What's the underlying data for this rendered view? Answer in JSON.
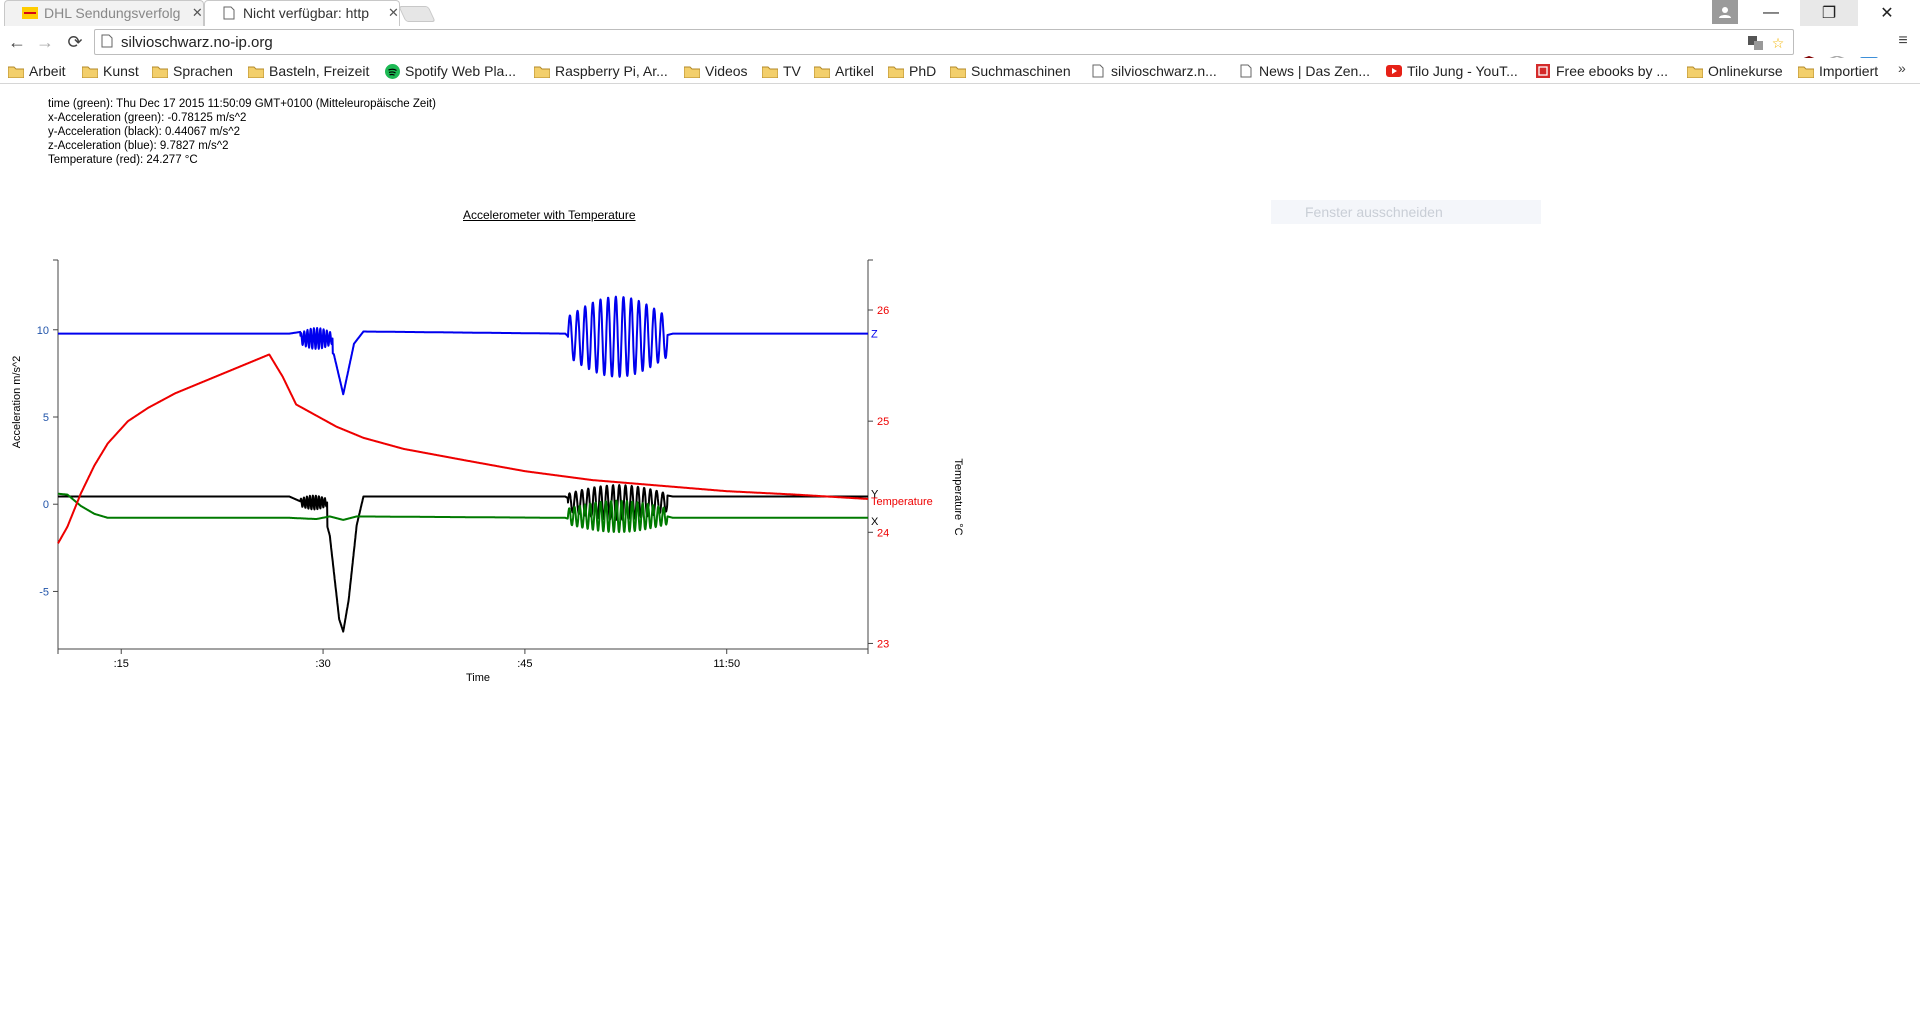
{
  "browser": {
    "tabs": [
      {
        "title": "DHL Sendungsverfolg",
        "active": false,
        "icon": "dhl-icon"
      },
      {
        "title": "Nicht verfügbar: http",
        "active": true,
        "icon": "page-icon"
      }
    ],
    "url": "silvioschwarz.no-ip.org",
    "window_controls": [
      "minimize",
      "restore",
      "close"
    ],
    "bookmarks": [
      {
        "label": "Arbeit",
        "icon": "folder-icon"
      },
      {
        "label": "Kunst",
        "icon": "folder-icon"
      },
      {
        "label": "Sprachen",
        "icon": "folder-icon"
      },
      {
        "label": "Basteln, Freizeit",
        "icon": "folder-icon"
      },
      {
        "label": "Spotify Web Pla...",
        "icon": "spotify-icon"
      },
      {
        "label": "Raspberry Pi, Ar...",
        "icon": "folder-icon"
      },
      {
        "label": "Videos",
        "icon": "folder-icon"
      },
      {
        "label": "TV",
        "icon": "folder-icon"
      },
      {
        "label": "Artikel",
        "icon": "folder-icon"
      },
      {
        "label": "PhD",
        "icon": "folder-icon"
      },
      {
        "label": "Suchmaschinen",
        "icon": "folder-icon"
      },
      {
        "label": "silvioschwarz.n...",
        "icon": "page-icon"
      },
      {
        "label": "News | Das Zen...",
        "icon": "page-icon"
      },
      {
        "label": "Tilo Jung - YouT...",
        "icon": "youtube-icon"
      },
      {
        "label": "Free ebooks by ...",
        "icon": "ebook-icon"
      },
      {
        "label": "Onlinekurse",
        "icon": "folder-icon"
      },
      {
        "label": "Importiert",
        "icon": "folder-icon"
      }
    ],
    "overflow": "»"
  },
  "readout": {
    "time": "time (green): Thu Dec 17 2015 11:50:09 GMT+0100 (Mitteleuropäische Zeit)",
    "x": "x-Acceleration (green): -0.78125 m/s^2",
    "y": "y-Acceleration (black): 0.44067 m/s^2",
    "z": "z-Acceleration (blue): 9.7827 m/s^2",
    "temp": "Temperature (red): 24.277 °C"
  },
  "ghost_tooltip": "Fenster ausschneiden",
  "chart_data": {
    "type": "line",
    "title": "Accelerometer with Temperature",
    "xlabel": "Time",
    "ylabel_left": "Acceleration m/s^2",
    "ylabel_right": "Temperature °C",
    "x_ticks": [
      ":15",
      ":30",
      ":45",
      "11:50"
    ],
    "x_tick_seconds": [
      15,
      30,
      45,
      60
    ],
    "xlim": [
      10.3,
      70.5
    ],
    "ylim_left": [
      -8.3,
      14
    ],
    "ylim_right": [
      22.95,
      26.45
    ],
    "y_ticks_left": [
      10,
      5,
      0,
      -5
    ],
    "y_ticks_right": [
      26,
      25,
      24,
      23
    ],
    "series_labels": {
      "z": "Z",
      "y": "Y",
      "x": "X",
      "temperature": "Temperature"
    },
    "colors": {
      "z": "#0000ee",
      "y": "#000000",
      "x": "#007a00",
      "temperature": "#ee0000",
      "left_axis": "#2255aa",
      "right_axis": "#ee0000"
    },
    "series": [
      {
        "name": "Z",
        "color": "#0000ee",
        "axis": "left",
        "points": [
          [
            10.3,
            9.78
          ],
          [
            27.5,
            9.78
          ],
          [
            28.5,
            9.9
          ],
          [
            29.5,
            9.4
          ],
          [
            30.8,
            8.6
          ],
          [
            31.5,
            6.3
          ],
          [
            32.3,
            9.2
          ],
          [
            33,
            9.9
          ],
          [
            48,
            9.78
          ],
          [
            48.5,
            9.4
          ],
          [
            55.6,
            9.7
          ],
          [
            56,
            9.78
          ],
          [
            70.5,
            9.78
          ]
        ]
      },
      {
        "name": "Y",
        "color": "#000000",
        "axis": "left",
        "points": [
          [
            10.3,
            0.44
          ],
          [
            27.5,
            0.44
          ],
          [
            28.5,
            0.1
          ],
          [
            29.8,
            0.2
          ],
          [
            30.5,
            -1.8
          ],
          [
            31.2,
            -6.6
          ],
          [
            31.5,
            -7.3
          ],
          [
            31.9,
            -5.5
          ],
          [
            32.5,
            -1.2
          ],
          [
            33,
            0.44
          ],
          [
            48,
            0.44
          ],
          [
            48.5,
            0.2
          ],
          [
            55.6,
            0.5
          ],
          [
            56,
            0.44
          ],
          [
            70.5,
            0.44
          ]
        ]
      },
      {
        "name": "X",
        "color": "#007a00",
        "axis": "left",
        "points": [
          [
            10.3,
            0.6
          ],
          [
            11,
            0.55
          ],
          [
            12,
            -0.1
          ],
          [
            13,
            -0.55
          ],
          [
            14,
            -0.78
          ],
          [
            27.5,
            -0.78
          ],
          [
            29.5,
            -0.85
          ],
          [
            30.5,
            -0.7
          ],
          [
            31.5,
            -0.9
          ],
          [
            32.5,
            -0.7
          ],
          [
            48,
            -0.78
          ],
          [
            48.5,
            -0.9
          ],
          [
            55.6,
            -0.7
          ],
          [
            56,
            -0.78
          ],
          [
            70.5,
            -0.78
          ]
        ]
      },
      {
        "name": "Temperature",
        "color": "#ee0000",
        "axis": "right",
        "points": [
          [
            10.3,
            23.9
          ],
          [
            11,
            24.05
          ],
          [
            12,
            24.35
          ],
          [
            13,
            24.6
          ],
          [
            14,
            24.8
          ],
          [
            15.5,
            25.0
          ],
          [
            17,
            25.12
          ],
          [
            19,
            25.25
          ],
          [
            21,
            25.35
          ],
          [
            23,
            25.45
          ],
          [
            25,
            25.55
          ],
          [
            26,
            25.6
          ],
          [
            27,
            25.4
          ],
          [
            28,
            25.15
          ],
          [
            29.5,
            25.05
          ],
          [
            31,
            24.95
          ],
          [
            33,
            24.85
          ],
          [
            36,
            24.75
          ],
          [
            40,
            24.66
          ],
          [
            45,
            24.55
          ],
          [
            50,
            24.47
          ],
          [
            55,
            24.42
          ],
          [
            60,
            24.37
          ],
          [
            65,
            24.34
          ],
          [
            70.5,
            24.3
          ]
        ]
      }
    ],
    "oscillations": [
      {
        "series": "Z",
        "x0": 28.3,
        "x1": 30.7,
        "center": 9.5,
        "amplitude": 0.6,
        "cycles": 10
      },
      {
        "series": "Z",
        "x0": 48.2,
        "x1": 55.6,
        "center": 9.6,
        "amplitude": 2.3,
        "cycles": 13
      },
      {
        "series": "Y",
        "x0": 28.3,
        "x1": 30.3,
        "center": 0.1,
        "amplitude": 0.4,
        "cycles": 9
      },
      {
        "series": "Y",
        "x0": 48.2,
        "x1": 55.6,
        "center": 0.1,
        "amplitude": 1.0,
        "cycles": 16
      },
      {
        "series": "X",
        "x0": 48.2,
        "x1": 55.6,
        "center": -0.7,
        "amplitude": 0.9,
        "cycles": 19
      }
    ]
  }
}
